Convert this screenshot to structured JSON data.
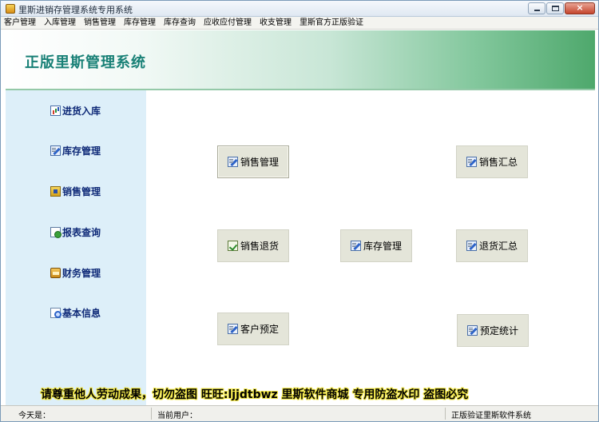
{
  "window": {
    "title": "里斯进销存管理系统专用系统",
    "controls": {
      "minimize": "minimize-icon",
      "maximize": "maximize-icon",
      "close": "×"
    }
  },
  "menu": {
    "items": [
      "客户管理",
      "入库管理",
      "销售管理",
      "库存管理",
      "库存查询",
      "应收应付管理",
      "收支管理",
      "里斯官方正版验证"
    ]
  },
  "banner": {
    "title": "正版里斯管理系统"
  },
  "sidebar": {
    "items": [
      {
        "label": "进货入库",
        "icon": "chart-icon"
      },
      {
        "label": "库存管理",
        "icon": "edit-icon"
      },
      {
        "label": "销售管理",
        "icon": "book-icon"
      },
      {
        "label": "报表查询",
        "icon": "document-icon"
      },
      {
        "label": "财务管理",
        "icon": "wallet-icon"
      },
      {
        "label": "基本信息",
        "icon": "magnify-icon"
      }
    ]
  },
  "main": {
    "buttons": [
      {
        "label": "销售管理",
        "icon": "edit-icon"
      },
      {
        "label": "销售汇总",
        "icon": "edit-icon"
      },
      {
        "label": "销售退货",
        "icon": "check-icon"
      },
      {
        "label": "库存管理",
        "icon": "edit-icon"
      },
      {
        "label": "退货汇总",
        "icon": "edit-icon"
      },
      {
        "label": "客户预定",
        "icon": "edit-icon"
      },
      {
        "label": "预定统计",
        "icon": "edit-icon"
      }
    ]
  },
  "watermark": {
    "text": "请尊重他人劳动成果，切勿盗图 旺旺:ljjdtbwz 里斯软件商城 专用防盗水印 盗图必究"
  },
  "status": {
    "today_label": "今天是：",
    "current_user_label": "当前用户：",
    "verified_text": "正版验证里斯软件系统"
  },
  "colors": {
    "banner_title": "#188076",
    "nav_text": "#0f2a78",
    "sidebar_bg": "#ddeff9",
    "button_bg": "#e4e5d9",
    "watermark_outline": "#f4e94a"
  }
}
